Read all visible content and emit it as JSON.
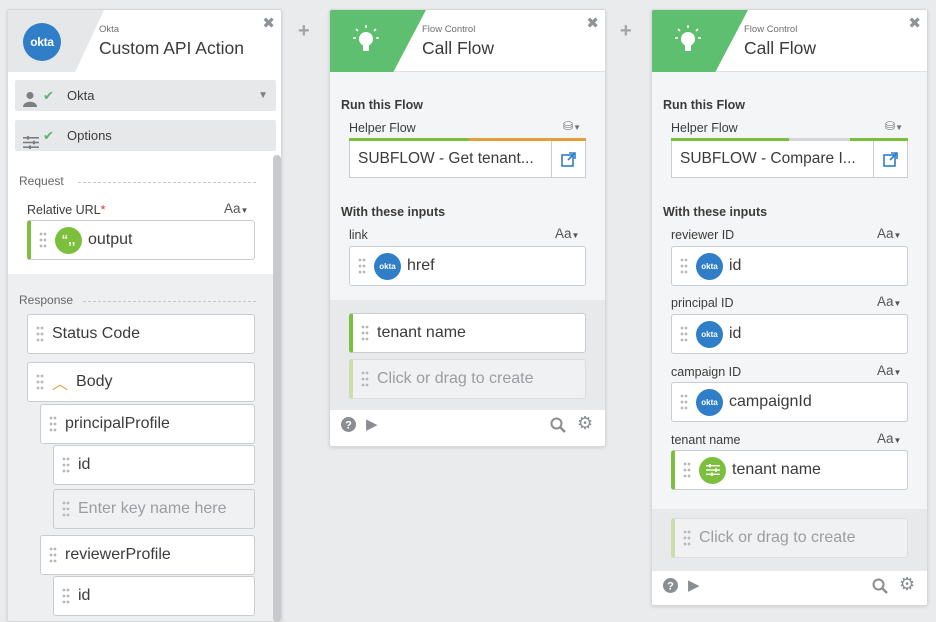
{
  "card1": {
    "subtitle": "Okta",
    "title": "Custom API Action",
    "logo_text": "okta",
    "connection_label": "Okta",
    "options_label": "Options",
    "request_label": "Request",
    "relative_url_label": "Relative URL",
    "required_mark": "*",
    "aa_label": "Aa",
    "relative_url_value": "output",
    "response_label": "Response",
    "status_code": "Status Code",
    "body": "Body",
    "principal_profile": "principalProfile",
    "principal_id": "id",
    "enter_key_placeholder": "Enter key name here",
    "reviewer_profile": "reviewerProfile",
    "reviewer_id": "id"
  },
  "card2": {
    "subtitle": "Flow Control",
    "title": "Call Flow",
    "run_label": "Run this Flow",
    "helper_label": "Helper Flow",
    "helper_value": "SUBFLOW - Get tenant...",
    "inputs_label": "With these inputs",
    "link_label": "link",
    "aa_label": "Aa",
    "link_value": "href",
    "badge_text": "okta",
    "output_tenant": "tenant name",
    "create_placeholder": "Click or drag to create"
  },
  "card3": {
    "subtitle": "Flow Control",
    "title": "Call Flow",
    "run_label": "Run this Flow",
    "helper_label": "Helper Flow",
    "helper_value": "SUBFLOW - Compare I...",
    "inputs_label": "With these inputs",
    "aa_label": "Aa",
    "badge_text": "okta",
    "reviewer_label": "reviewer ID",
    "reviewer_value": "id",
    "principal_label": "principal ID",
    "principal_value": "id",
    "campaign_label": "campaign ID",
    "campaign_value": "campaignId",
    "tenant_label": "tenant name",
    "tenant_value": "tenant name",
    "create_placeholder": "Click or drag to create"
  },
  "colors": {
    "okta_blue": "#2f7ec7",
    "flow_green": "#5fbf70",
    "mapping_green": "#7cbf3c",
    "helper_bar_orange": "#e69d3c"
  }
}
